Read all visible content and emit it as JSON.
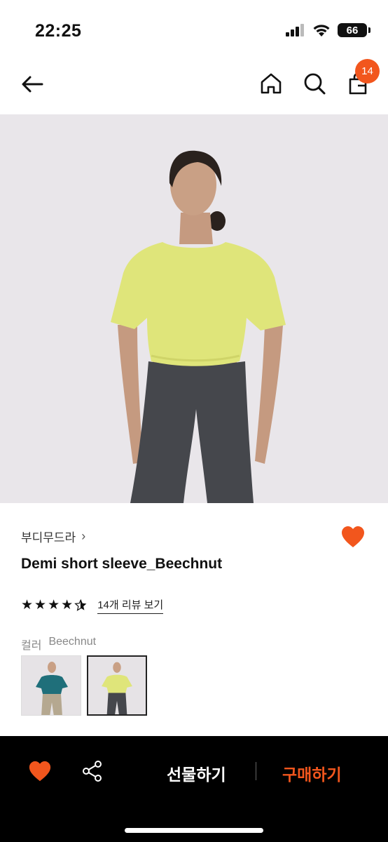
{
  "status_bar": {
    "time": "22:25",
    "battery": "66"
  },
  "nav": {
    "cart_count": "14"
  },
  "product": {
    "brand": "부디무드라",
    "name": "Demi short sleeve_Beechnut",
    "rating": 4.5,
    "review_link": "14개 리뷰 보기",
    "color_label": "컬러",
    "color_value": "Beechnut"
  },
  "bottom_bar": {
    "gift_label": "선물하기",
    "buy_label": "구매하기"
  },
  "colors": {
    "accent": "#f2561d",
    "shirt_selected": "#dfe57a",
    "shirt_other": "#1f6f7a",
    "leggings": "#45474c",
    "background": "#e9e6ea"
  }
}
